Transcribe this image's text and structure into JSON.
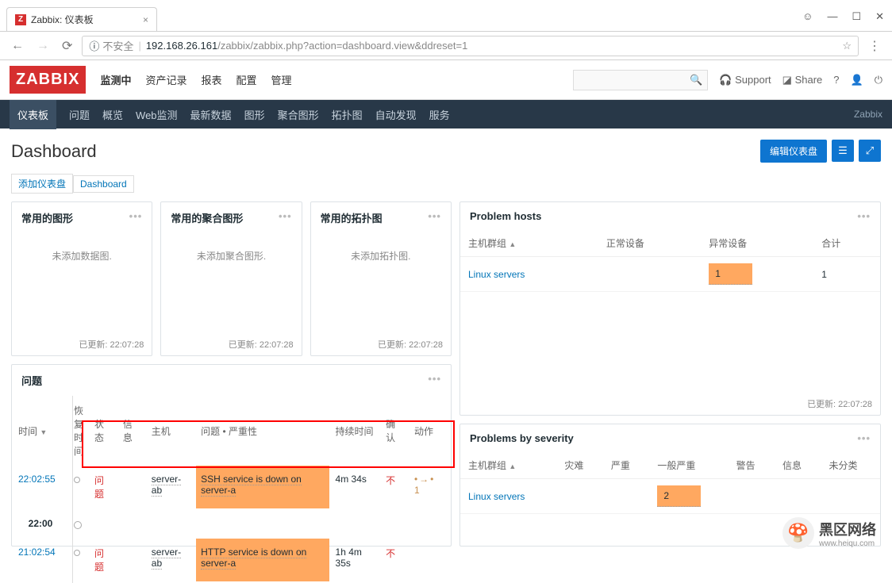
{
  "browser": {
    "tab_title": "Zabbix: 仪表板",
    "url_insecure": "不安全",
    "url_host_path": "192.168.26.161",
    "url_rest": "/zabbix/zabbix.php?action=dashboard.view&ddreset=1"
  },
  "header": {
    "logo": "ZABBIX",
    "menu": [
      "监测中",
      "资产记录",
      "报表",
      "配置",
      "管理"
    ],
    "support": "Support",
    "share": "Share"
  },
  "subnav": {
    "items": [
      "仪表板",
      "问题",
      "概览",
      "Web监测",
      "最新数据",
      "图形",
      "聚合图形",
      "拓扑图",
      "自动发现",
      "服务"
    ],
    "right": "Zabbix"
  },
  "dashboard": {
    "title": "Dashboard",
    "edit_btn": "编辑仪表盘",
    "breadcrumb_add": "添加仪表盘",
    "breadcrumb_current": "Dashboard"
  },
  "widgets_small": [
    {
      "title": "常用的图形",
      "empty": "未添加数据图.",
      "updated": "已更新: 22:07:28"
    },
    {
      "title": "常用的聚合图形",
      "empty": "未添加聚合图形.",
      "updated": "已更新: 22:07:28"
    },
    {
      "title": "常用的拓扑图",
      "empty": "未添加拓扑图.",
      "updated": "已更新: 22:07:28"
    }
  ],
  "problem_hosts": {
    "title": "Problem hosts",
    "cols": [
      "主机群组",
      "正常设备",
      "异常设备",
      "合计"
    ],
    "row": {
      "group": "Linux servers",
      "ok": "",
      "bad": "1",
      "total": "1"
    },
    "updated": "已更新: 22:07:28"
  },
  "problems_widget": {
    "title": "问题",
    "cols": [
      "时间",
      "恢复时间",
      "状态",
      "信息",
      "主机",
      "问题 • 严重性",
      "持续时间",
      "确认",
      "动作"
    ],
    "row1": {
      "time": "22:02:55",
      "status": "问题",
      "host": "server-ab",
      "problem": "SSH service is down on server-a",
      "duration": "4m 34s",
      "ack": "不",
      "actions": "1"
    },
    "divider": "22:00",
    "row2": {
      "time": "21:02:54",
      "status": "问题",
      "host": "server-ab",
      "problem": "HTTP service is down on server-a",
      "duration": "1h 4m 35s",
      "ack": "不",
      "actions": ""
    }
  },
  "severity_widget": {
    "title": "Problems by severity",
    "cols": [
      "主机群组",
      "灾难",
      "严重",
      "一般严重",
      "警告",
      "信息",
      "未分类"
    ],
    "row": {
      "group": "Linux servers",
      "avg": "2"
    }
  },
  "overlay": {
    "cn": "黑区网络",
    "en": "www.heiqu.com"
  }
}
